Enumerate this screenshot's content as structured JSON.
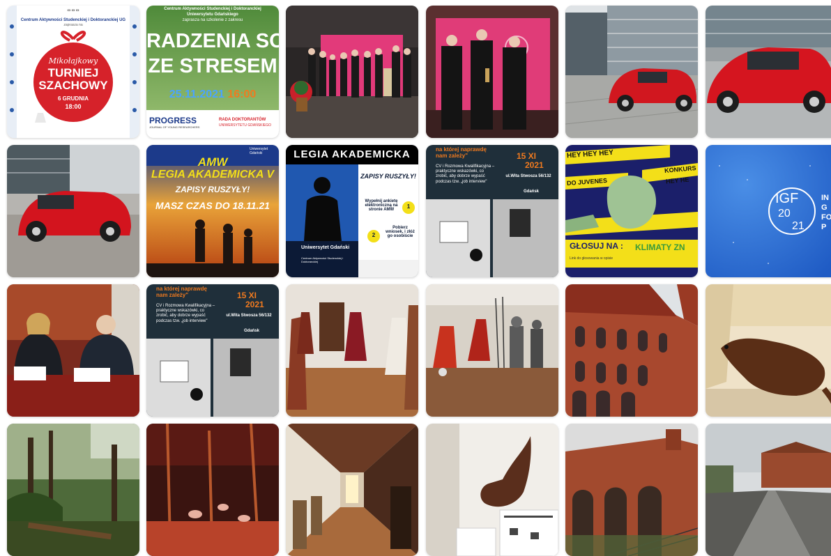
{
  "colors": {
    "accent_red": "#d6222a",
    "brand_blue": "#1c3a8a",
    "navy": "#13294b",
    "orange": "#f07a1f",
    "yellow": "#f3df19"
  },
  "posts": [
    {
      "theme": "chess-poster",
      "header": "Centrum Aktywności Studenckiej i Doktoranckiej UG",
      "sub": "zaprasza na",
      "title_a": "Mikołajkowy",
      "title_b": "TURNIEJ",
      "title_c": "SZACHOWY",
      "date": "6 GRUDNIA",
      "time": "18:00"
    },
    {
      "theme": "stress-poster",
      "top": "Centrum Aktywności Studenckiej i Doktoranckiej",
      "top2": "Uniwersytetu Gdańskiego",
      "top3": "zaprasza na szkolenie z zakresu",
      "line1": "RADZENIA SOBIE",
      "line2": "ZE STRESEM",
      "date": "25.11.2021",
      "time": "16:00",
      "logo1": "PROGRESS",
      "logo1_sub": "JOURNAL OF YOUNG RESEARCHERS",
      "logo2": "RADA DOKTORANTÓW",
      "logo2_sub": "UNIWERSYTETU GDAŃSKIEGO"
    },
    {
      "theme": "photo-award-group"
    },
    {
      "theme": "photo-award-trio"
    },
    {
      "theme": "photo-car-building"
    },
    {
      "theme": "photo-car-side"
    },
    {
      "theme": "photo-car-front"
    },
    {
      "theme": "amw-poster",
      "title": "AMW",
      "line1": "LEGIA AKADEMICKA V",
      "line2": "ZAPISY RUSZYŁY!",
      "line3": "MASZ CZAS DO",
      "date": "18.11.21",
      "badge": "Uniwersytet Gdański"
    },
    {
      "theme": "legia-poster",
      "title": "LEGIA AKADEMICKA",
      "sub": "ZAPISY RUSZYŁY!",
      "step1": "Wypełnij ankietę elektroniczną na stronie AMW",
      "step2": "Pobierz wniosek, i złóż go osobiście",
      "n1": "1",
      "n2": "2",
      "uni": "Uniwersytet Gdański",
      "uni_sub": "Centrum Aktywności Studenckiej i Doktoranckiej"
    },
    {
      "theme": "cv-poster",
      "q1": "na której naprawdę",
      "q2": "nam zależy\"",
      "desc": "CV i Rozmowa Kwalifikacyjna – praktyczne wskazówki, co zrobić, aby dobrze wypaść podczas tzw. „job interview\"",
      "date": "15 XI",
      "year": "2021",
      "addr": "ul.Wita Stwosza 56/132",
      "city": "Gdańsk"
    },
    {
      "theme": "konkurs-poster",
      "tape1": "HEY HEY HEY",
      "tape2": "KONKURS",
      "tape3": "HEY HE",
      "tape4": "DO JUVENES",
      "vote": "GŁOSUJ NA :",
      "brand": "KLIMATY ZN",
      "small": "Link do głosowania w opisie"
    },
    {
      "theme": "igf-poster",
      "logo": "IGF",
      "year_a": "20",
      "year_b": "21",
      "side": "IN",
      "side2": "G",
      "side3": "FO",
      "side4": "P"
    },
    {
      "theme": "photo-signing"
    },
    {
      "theme": "cv-poster",
      "q1": "na której naprawdę",
      "q2": "nam zależy\"",
      "desc": "CV i Rozmowa Kwalifikacyjna – praktyczne wskazówki, co zrobić, aby dobrze wypaść podczas tzw. „job interview\"",
      "date": "15 XI",
      "year": "2021",
      "addr": "ul.Wita Stwosza 56/132",
      "city": "Gdańsk"
    },
    {
      "theme": "photo-museum-costumes"
    },
    {
      "theme": "photo-museum-armor"
    },
    {
      "theme": "photo-castle-facade"
    },
    {
      "theme": "photo-otter"
    },
    {
      "theme": "photo-diorama-forest"
    },
    {
      "theme": "photo-diorama-red"
    },
    {
      "theme": "photo-corridor"
    },
    {
      "theme": "photo-rhino"
    },
    {
      "theme": "photo-castle-bridge"
    },
    {
      "theme": "photo-castle-path"
    }
  ]
}
